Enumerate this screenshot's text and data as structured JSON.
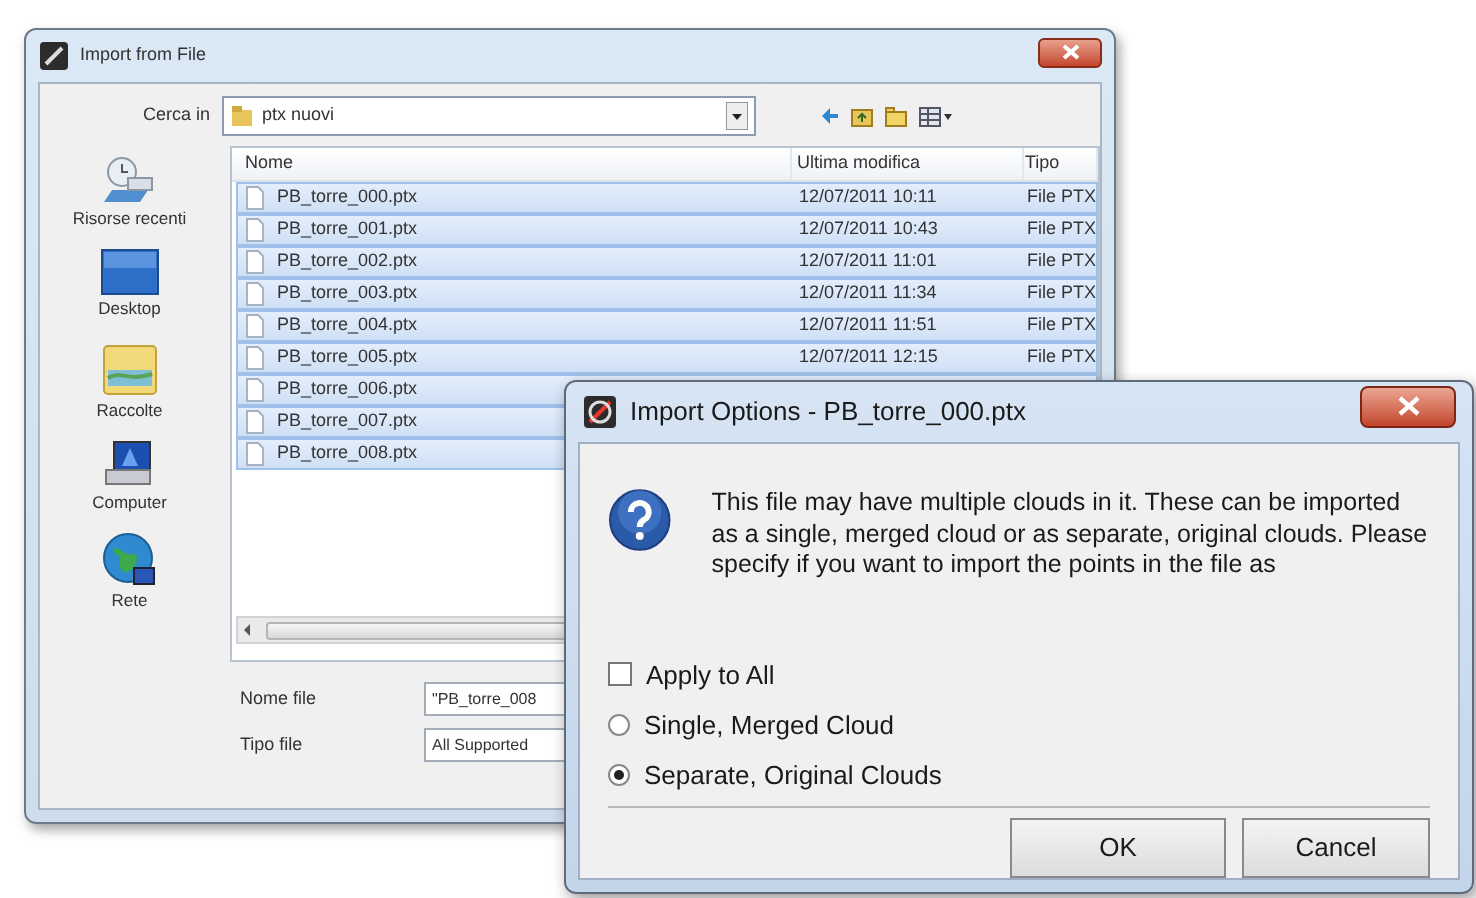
{
  "file_dialog": {
    "title": "Import from File",
    "look_in_label": "Cerca in",
    "look_in_value": "ptx nuovi",
    "places": [
      {
        "label": "Risorse recenti",
        "kind": "recent"
      },
      {
        "label": "Desktop",
        "kind": "desktop"
      },
      {
        "label": "Raccolte",
        "kind": "libraries"
      },
      {
        "label": "Computer",
        "kind": "computer"
      },
      {
        "label": "Rete",
        "kind": "network"
      }
    ],
    "columns": [
      "Nome",
      "Ultima modifica",
      "Tipo"
    ],
    "files": [
      {
        "name": "PB_torre_000.ptx",
        "modified": "12/07/2011 10:11",
        "type": "File PTX",
        "selected": true
      },
      {
        "name": "PB_torre_001.ptx",
        "modified": "12/07/2011 10:43",
        "type": "File PTX",
        "selected": true
      },
      {
        "name": "PB_torre_002.ptx",
        "modified": "12/07/2011 11:01",
        "type": "File PTX",
        "selected": true
      },
      {
        "name": "PB_torre_003.ptx",
        "modified": "12/07/2011 11:34",
        "type": "File PTX",
        "selected": true
      },
      {
        "name": "PB_torre_004.ptx",
        "modified": "12/07/2011 11:51",
        "type": "File PTX",
        "selected": true
      },
      {
        "name": "PB_torre_005.ptx",
        "modified": "12/07/2011 12:15",
        "type": "File PTX",
        "selected": true
      },
      {
        "name": "PB_torre_006.ptx",
        "selected": true
      },
      {
        "name": "PB_torre_007.ptx",
        "selected": true
      },
      {
        "name": "PB_torre_008.ptx",
        "selected": true
      }
    ],
    "file_name_label": "Nome file",
    "file_name_value": "\"PB_torre_008",
    "file_type_label": "Tipo file",
    "file_type_value": "All Supported"
  },
  "options_dialog": {
    "title": "Import Options - PB_torre_000.ptx",
    "message": "This file may have multiple clouds in it. These can be imported as a single, merged cloud or as separate, original clouds. Please specify if you want to import the points in the file as",
    "apply_to_all": {
      "label": "Apply to All",
      "checked": false
    },
    "choices": [
      {
        "label": "Single, Merged Cloud",
        "selected": false
      },
      {
        "label": "Separate, Original Clouds",
        "selected": true
      }
    ],
    "buttons": [
      "OK",
      "Cancel"
    ]
  }
}
